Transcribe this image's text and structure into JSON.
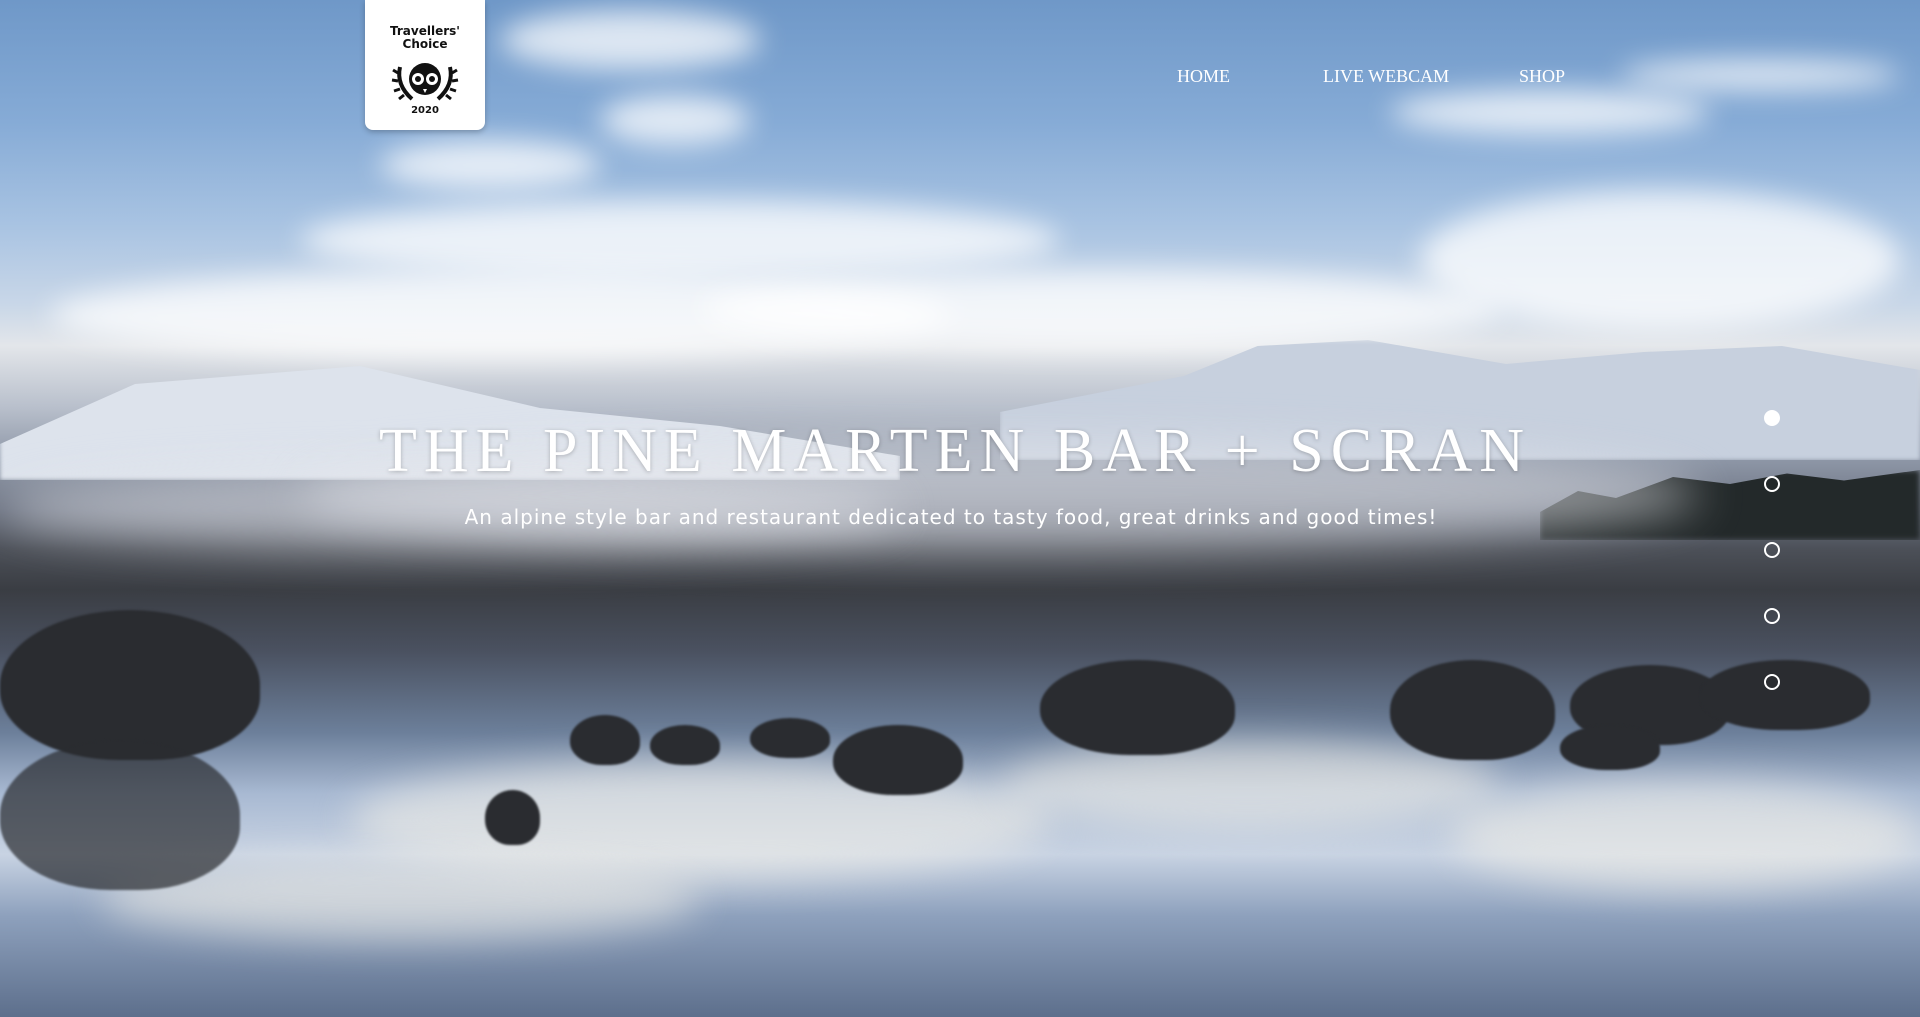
{
  "badge": {
    "line1": "Travellers'",
    "line2": "Choice",
    "year": "2020",
    "icon": "owl-eyes-icon"
  },
  "nav": {
    "items": [
      {
        "label": "HOME"
      },
      {
        "label": "LIVE WEBCAM"
      },
      {
        "label": "SHOP"
      }
    ]
  },
  "hero": {
    "title": "THE PINE MARTEN BAR + SCRAN",
    "subtitle": "An alpine style bar and restaurant dedicated to tasty food, great drinks and good times!"
  },
  "slider": {
    "count": 5,
    "active_index": 0
  },
  "colors": {
    "text": "#ffffff",
    "badge_bg": "#ffffff"
  }
}
